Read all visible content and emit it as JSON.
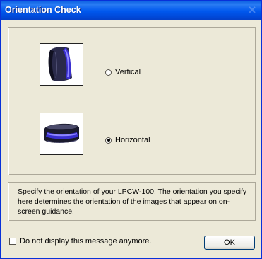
{
  "window": {
    "title": "Orientation Check",
    "close_icon": "close-icon"
  },
  "options": [
    {
      "label": "Vertical",
      "selected": false,
      "image": "vertical-device-image"
    },
    {
      "label": "Horizontal",
      "selected": true,
      "image": "horizontal-device-image"
    }
  ],
  "message": "Specify the orientation of your LPCW-100. The orientation you specify here determines the orientation of the images that appear on on-screen guidance.",
  "footer": {
    "checkbox_label": "Do not display this message anymore.",
    "checkbox_checked": false,
    "ok_label": "OK"
  },
  "colors": {
    "title_bar": "#0058ee",
    "window_bg": "#ece9d8",
    "device_accent": "#3a2fd0"
  }
}
